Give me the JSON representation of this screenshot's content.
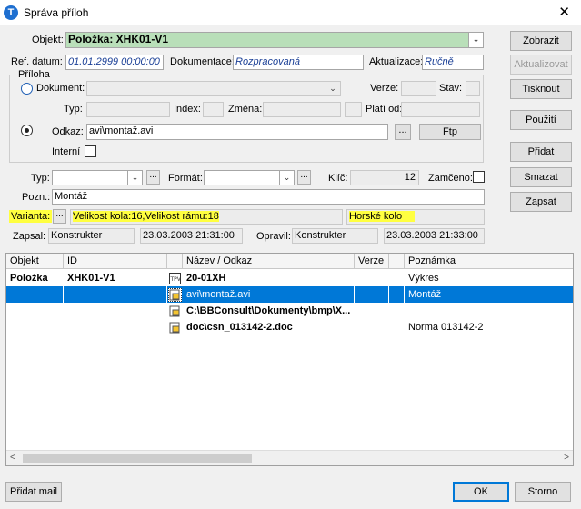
{
  "window": {
    "title": "Správa příloh",
    "close": "✕",
    "app_icon": "T"
  },
  "objekt": {
    "label": "Objekt:",
    "value": "Položka: XHK01-V1"
  },
  "ref": {
    "label": "Ref. datum:",
    "value": "01.01.2999 00:00:00"
  },
  "dokumentace": {
    "label": "Dokumentace:",
    "value": "Rozpracovaná"
  },
  "aktualizace": {
    "label": "Aktualizace:",
    "value": "Ručně"
  },
  "priloha": {
    "legend": "Příloha",
    "dokument_label": "Dokument:",
    "verze_label": "Verze:",
    "stav_label": "Stav:",
    "typ_label": "Typ:",
    "index_label": "Index:",
    "zmena_label": "Změna:",
    "platiod_label": "Platí od:",
    "odkaz_label": "Odkaz:",
    "odkaz_value": "avi\\montaž.avi",
    "interni_label": "Interní",
    "browse": "..."
  },
  "typ": {
    "label": "Typ:"
  },
  "format": {
    "label": "Formát:"
  },
  "klic": {
    "label": "Klíč:",
    "value": "12"
  },
  "zamceno": {
    "label": "Zamčeno:"
  },
  "pozn": {
    "label": "Pozn.:",
    "value": "Montáž"
  },
  "varianta": {
    "label": "Varianta:",
    "value": "Velikost kola:16,Velikost rámu:18",
    "value2": "Horské kolo"
  },
  "zapsal": {
    "label": "Zapsal:",
    "user": "Konstrukter",
    "date": "23.03.2003 21:31:00"
  },
  "opravil": {
    "label": "Opravil:",
    "user": "Konstrukter",
    "date": "23.03.2003 21:33:00"
  },
  "buttons": {
    "zobrazit": "Zobrazit",
    "aktualizovat": "Aktualizovat",
    "tisknout": "Tisknout",
    "pouziti": "Použití",
    "pridat": "Přidat",
    "smazat": "Smazat",
    "zapsat": "Zapsat",
    "ftp": "Ftp",
    "pridat_mail": "Přidat mail",
    "ok": "OK",
    "storno": "Storno"
  },
  "grid": {
    "headers": [
      "Objekt",
      "ID",
      "",
      "Název / Odkaz",
      "Verze",
      "",
      "Poznámka"
    ],
    "rows": [
      {
        "objekt": "Položka",
        "id": "XHK01-V1",
        "icon": "drawing-icon",
        "nazev": "20-01XH",
        "verze": "",
        "poznamka": "Výkres"
      },
      {
        "objekt": "",
        "id": "",
        "icon": "link-file-icon",
        "nazev": "avi\\montaž.avi",
        "verze": "",
        "poznamka": "Montáž"
      },
      {
        "objekt": "",
        "id": "",
        "icon": "link-file-icon",
        "nazev": "C:\\BBConsult\\Dokumenty\\bmp\\X...",
        "verze": "",
        "poznamka": ""
      },
      {
        "objekt": "",
        "id": "",
        "icon": "link-file-icon",
        "nazev": "doc\\csn_013142-2.doc",
        "verze": "",
        "poznamka": "Norma 013142-2"
      }
    ]
  },
  "colors": {
    "highlight": "#ffff40",
    "selection": "#0078d7",
    "objekt_bg": "#b9dfb9"
  }
}
